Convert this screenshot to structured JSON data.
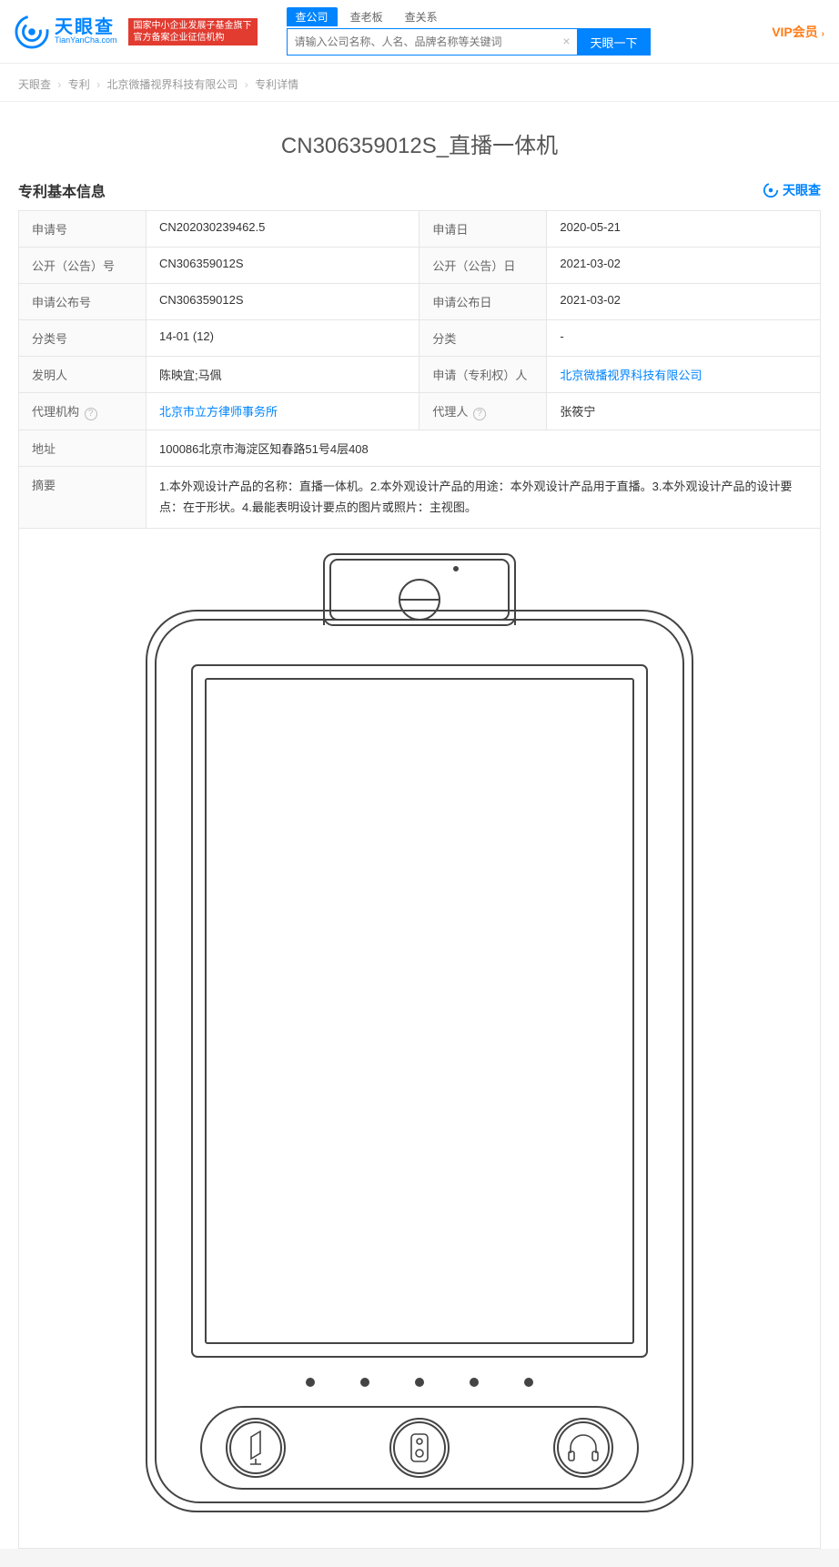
{
  "header": {
    "logo_cn": "天眼查",
    "logo_en": "TianYanCha.com",
    "red_badge_line1": "国家中小企业发展子基金旗下",
    "red_badge_line2": "官方备案企业征信机构",
    "search_tabs": [
      "查公司",
      "查老板",
      "查关系"
    ],
    "search_placeholder": "请输入公司名称、人名、品牌名称等关键词",
    "search_button": "天眼一下",
    "vip_label": "VIP会员"
  },
  "breadcrumb": {
    "items": [
      "天眼查",
      "专利",
      "北京微播视界科技有限公司",
      "专利详情"
    ]
  },
  "page_title": "CN306359012S_直播一体机",
  "section_title": "专利基本信息",
  "watermark_text": "天眼查",
  "info_rows": [
    {
      "l1": "申请号",
      "v1": "CN202030239462.5",
      "l2": "申请日",
      "v2": "2020-05-21"
    },
    {
      "l1": "公开（公告）号",
      "v1": "CN306359012S",
      "l2": "公开（公告）日",
      "v2": "2021-03-02"
    },
    {
      "l1": "申请公布号",
      "v1": "CN306359012S",
      "l2": "申请公布日",
      "v2": "2021-03-02"
    },
    {
      "l1": "分类号",
      "v1": "14-01 (12)",
      "l2": "分类",
      "v2": "-"
    },
    {
      "l1": "发明人",
      "v1": "陈映宜;马佩",
      "l2": "申请（专利权）人",
      "v2": "北京微播视界科技有限公司",
      "v2_link": true
    },
    {
      "l1": "代理机构",
      "v1": "北京市立方律师事务所",
      "v1_link": true,
      "l1_q": true,
      "l2": "代理人",
      "v2": "张筱宁",
      "l2_q": true
    }
  ],
  "address_row": {
    "label": "地址",
    "value": "100086北京市海淀区知春路51号4层408"
  },
  "abstract_row": {
    "label": "摘要",
    "value": "1.本外观设计产品的名称：直播一体机。2.本外观设计产品的用途：本外观设计产品用于直播。3.本外观设计产品的设计要点：在于形状。4.最能表明设计要点的图片或照片：主视图。"
  }
}
